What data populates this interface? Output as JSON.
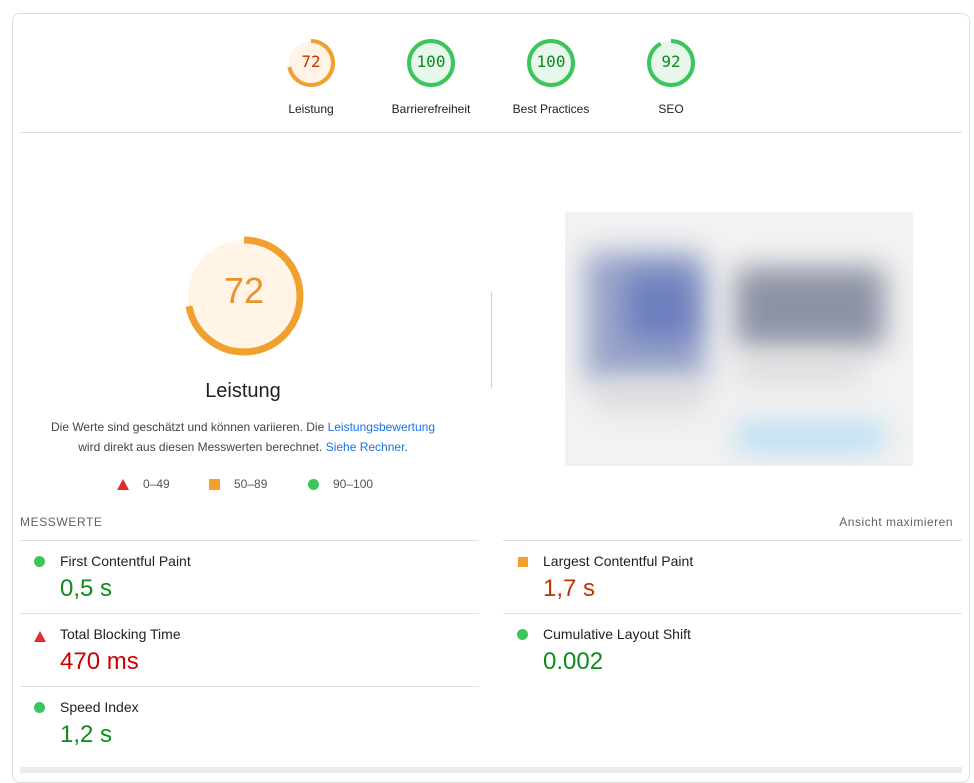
{
  "categories": [
    {
      "label": "Leistung",
      "score": "72",
      "fraction": 0.72,
      "color": "#f0a02c",
      "textColor": "#c33300",
      "bg": "#fff4e5"
    },
    {
      "label": "Barrierefreiheit",
      "score": "100",
      "fraction": 1.0,
      "color": "#3cc55b",
      "textColor": "#0c8c1c",
      "bg": "#e8f7ec"
    },
    {
      "label": "Best Practices",
      "score": "100",
      "fraction": 1.0,
      "color": "#3cc55b",
      "textColor": "#0c8c1c",
      "bg": "#e8f7ec"
    },
    {
      "label": "SEO",
      "score": "92",
      "fraction": 0.92,
      "color": "#3cc55b",
      "textColor": "#0c8c1c",
      "bg": "#e8f7ec"
    }
  ],
  "main": {
    "score": "72",
    "fraction": 0.72,
    "title": "Leistung",
    "desc_part1": "Die Werte sind geschätzt und können variieren. Die ",
    "desc_link1": "Leistungsbewertung",
    "desc_part2": "wird direkt aus diesen Messwerten berechnet. ",
    "desc_link2": "Siehe Rechner",
    "desc_end": "."
  },
  "legend": {
    "fail": "0–49",
    "average": "50–89",
    "pass": "90–100"
  },
  "metrics_header": {
    "title": "MESSWERTE",
    "expand": "Ansicht maximieren"
  },
  "metrics": [
    {
      "name": "First Contentful Paint",
      "value": "0,5 s",
      "status": "pass"
    },
    {
      "name": "Largest Contentful Paint",
      "value": "1,7 s",
      "status": "average"
    },
    {
      "name": "Total Blocking Time",
      "value": "470 ms",
      "status": "fail"
    },
    {
      "name": "Cumulative Layout Shift",
      "value": "0.002",
      "status": "pass"
    },
    {
      "name": "Speed Index",
      "value": "1,2 s",
      "status": "pass"
    }
  ]
}
